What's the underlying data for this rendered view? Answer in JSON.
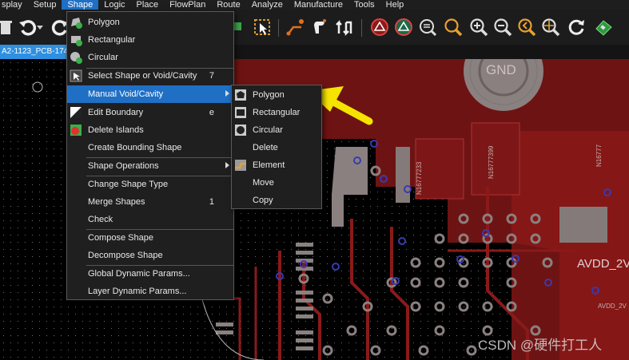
{
  "menubar": {
    "items": [
      "splay",
      "Setup",
      "Shape",
      "Logic",
      "Place",
      "FlowPlan",
      "Route",
      "Analyze",
      "Manufacture",
      "Tools",
      "Help"
    ]
  },
  "tab": {
    "label": "A2-1123_PCB-174"
  },
  "shape_menu": {
    "items": [
      {
        "label": "Polygon",
        "shortcut": "",
        "icon": "polygon-add-icon"
      },
      {
        "label": "Rectangular",
        "shortcut": "",
        "icon": "rectangle-add-icon"
      },
      {
        "label": "Circular",
        "shortcut": "",
        "icon": "circle-add-icon"
      },
      {
        "label": "Select Shape or Void/Cavity",
        "shortcut": "7",
        "icon": "select-shape-icon"
      },
      {
        "label": "Manual Void/Cavity",
        "shortcut": "",
        "icon": ""
      },
      {
        "label": "Edit Boundary",
        "shortcut": "e",
        "icon": "edit-boundary-icon"
      },
      {
        "label": "Delete Islands",
        "shortcut": "",
        "icon": "delete-islands-icon"
      },
      {
        "label": "Create Bounding Shape",
        "shortcut": ""
      },
      {
        "label": "Shape Operations",
        "shortcut": ""
      },
      {
        "label": "Change Shape Type",
        "shortcut": ""
      },
      {
        "label": "Merge Shapes",
        "shortcut": "1"
      },
      {
        "label": "Check",
        "shortcut": ""
      },
      {
        "label": "Compose Shape",
        "shortcut": ""
      },
      {
        "label": "Decompose Shape",
        "shortcut": ""
      },
      {
        "label": "Global Dynamic Params...",
        "shortcut": ""
      },
      {
        "label": "Layer Dynamic Params...",
        "shortcut": ""
      }
    ]
  },
  "void_submenu": {
    "items": [
      {
        "label": "Polygon",
        "icon": "void-polygon-icon"
      },
      {
        "label": "Rectangular",
        "icon": "void-rectangle-icon"
      },
      {
        "label": "Circular",
        "icon": "void-circle-icon"
      },
      {
        "label": "Delete",
        "icon": ""
      },
      {
        "label": "Element",
        "icon": "void-element-icon"
      },
      {
        "label": "Move",
        "icon": ""
      },
      {
        "label": "Copy",
        "icon": ""
      }
    ]
  },
  "board": {
    "labels": [
      "GND",
      "AVDD_2V",
      "AVDD_2V",
      "N16777233",
      "N16777399",
      "N16777"
    ]
  },
  "watermark": "CSDN @硬件打工人",
  "colors": {
    "accent": "#1f6fc5",
    "copper": "#7a1515",
    "highlight_arrow": "#f5e400"
  }
}
